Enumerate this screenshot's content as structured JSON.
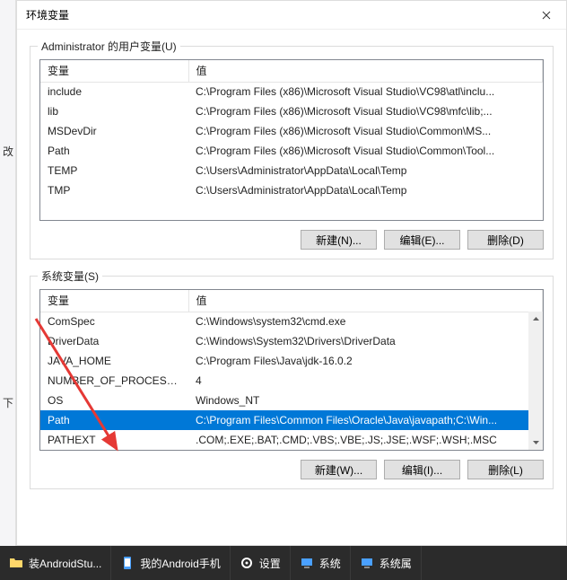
{
  "dialog": {
    "title": "环境变量"
  },
  "userGroup": {
    "legend": "Administrator 的用户变量(U)",
    "headers": {
      "variable": "变量",
      "value": "值"
    },
    "rows": [
      {
        "name": "include",
        "value": "C:\\Program Files (x86)\\Microsoft Visual Studio\\VC98\\atl\\inclu..."
      },
      {
        "name": "lib",
        "value": "C:\\Program Files (x86)\\Microsoft Visual Studio\\VC98\\mfc\\lib;..."
      },
      {
        "name": "MSDevDir",
        "value": "C:\\Program Files (x86)\\Microsoft Visual Studio\\Common\\MS..."
      },
      {
        "name": "Path",
        "value": "C:\\Program Files (x86)\\Microsoft Visual Studio\\Common\\Tool..."
      },
      {
        "name": "TEMP",
        "value": "C:\\Users\\Administrator\\AppData\\Local\\Temp"
      },
      {
        "name": "TMP",
        "value": "C:\\Users\\Administrator\\AppData\\Local\\Temp"
      }
    ],
    "buttons": {
      "new": "新建(N)...",
      "edit": "编辑(E)...",
      "delete": "删除(D)"
    }
  },
  "sysGroup": {
    "legend": "系统变量(S)",
    "headers": {
      "variable": "变量",
      "value": "值"
    },
    "rows": [
      {
        "name": "ComSpec",
        "value": "C:\\Windows\\system32\\cmd.exe"
      },
      {
        "name": "DriverData",
        "value": "C:\\Windows\\System32\\Drivers\\DriverData"
      },
      {
        "name": "JAVA_HOME",
        "value": "C:\\Program Files\\Java\\jdk-16.0.2"
      },
      {
        "name": "NUMBER_OF_PROCESSORS",
        "value": "4"
      },
      {
        "name": "OS",
        "value": "Windows_NT"
      },
      {
        "name": "Path",
        "value": "C:\\Program Files\\Common Files\\Oracle\\Java\\javapath;C:\\Win..."
      },
      {
        "name": "PATHEXT",
        "value": ".COM;.EXE;.BAT;.CMD;.VBS;.VBE;.JS;.JSE;.WSF;.WSH;.MSC"
      }
    ],
    "selectedIndex": 5,
    "buttons": {
      "new": "新建(W)...",
      "edit": "编辑(I)...",
      "delete": "删除(L)"
    }
  },
  "taskbar": {
    "items": [
      {
        "label": "装AndroidStu...",
        "icon": "folder"
      },
      {
        "label": "我的Android手机",
        "icon": "phone"
      },
      {
        "label": "设置",
        "icon": "gear"
      },
      {
        "label": "系统",
        "icon": "computer"
      },
      {
        "label": "系统属",
        "icon": "computer"
      }
    ]
  },
  "leftStrip": {
    "char1": "改",
    "char2": "下"
  }
}
